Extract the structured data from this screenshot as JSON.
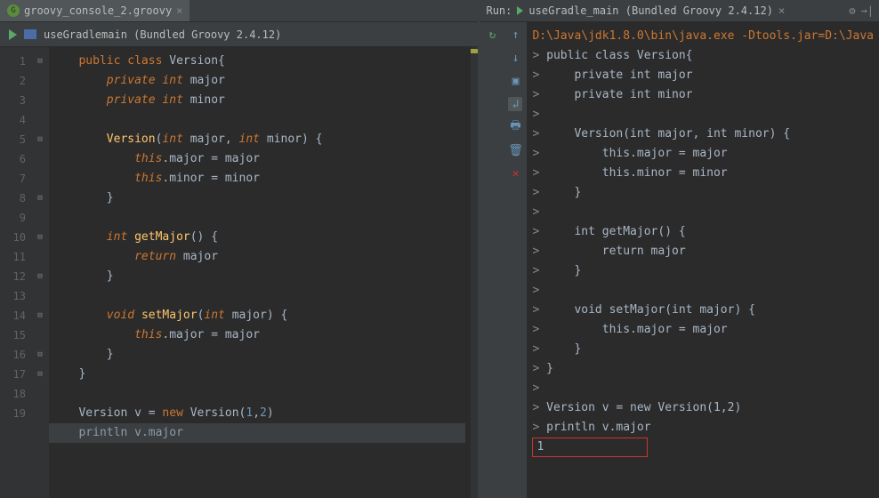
{
  "editor": {
    "tab": {
      "filename": "groovy_console_2.groovy"
    },
    "breadcrumb": "useGradlemain (Bundled Groovy 2.4.12)",
    "lines": [
      "1",
      "2",
      "3",
      "4",
      "5",
      "6",
      "7",
      "8",
      "9",
      "10",
      "11",
      "12",
      "13",
      "14",
      "15",
      "16",
      "17",
      "18",
      "19",
      ""
    ],
    "code": {
      "l1": {
        "pre": "   ",
        "kw1": "public",
        "sp1": " ",
        "kw2": "class",
        "sp2": " ",
        "name": "Version",
        "br": "{"
      },
      "l2": {
        "pre": "       ",
        "kw1": "private",
        "sp1": " ",
        "kw2": "int",
        "sp2": " ",
        "name": "major"
      },
      "l3": {
        "pre": "       ",
        "kw1": "private",
        "sp1": " ",
        "kw2": "int",
        "sp2": " ",
        "name": "minor"
      },
      "l5": {
        "pre": "       ",
        "name": "Version",
        "lp": "(",
        "kw1": "int",
        "sp1": " ",
        "p1": "major",
        "cm": ", ",
        "kw2": "int",
        "sp2": " ",
        "p2": "minor",
        "rp": ")",
        "sp3": " ",
        "br": "{"
      },
      "l6": {
        "pre": "           ",
        "kw": "this",
        "dot": ".",
        "f": "major",
        "eq": " = ",
        "v": "major"
      },
      "l7": {
        "pre": "           ",
        "kw": "this",
        "dot": ".",
        "f": "minor",
        "eq": " = ",
        "v": "minor"
      },
      "l8": {
        "pre": "       ",
        "br": "}"
      },
      "l10": {
        "pre": "       ",
        "kw": "int",
        "sp": " ",
        "name": "getMajor",
        "pr": "() {"
      },
      "l11": {
        "pre": "           ",
        "kw": "return",
        "sp": " ",
        "v": "major"
      },
      "l12": {
        "pre": "       ",
        "br": "}"
      },
      "l14": {
        "pre": "       ",
        "kw": "void",
        "sp": " ",
        "name": "setMajor",
        "lp": "(",
        "kw2": "int",
        "sp2": " ",
        "p": "major",
        "rp": ") {"
      },
      "l15": {
        "pre": "           ",
        "kw": "this",
        "dot": ".",
        "f": "major",
        "eq": " = ",
        "v": "major"
      },
      "l16": {
        "pre": "       ",
        "br": "}"
      },
      "l17": {
        "pre": "   ",
        "br": "}"
      },
      "l19": {
        "pre": "   ",
        "t": "Version",
        "sp": " ",
        "v": "v",
        "eq": " = ",
        "kw": "new",
        "sp2": " ",
        "cls": "Version",
        "lp": "(",
        "n1": "1",
        "cm": ",",
        "n2": "2",
        "rp": ")"
      },
      "l20": {
        "pre": "   ",
        "fn": "println",
        "sp": " ",
        "v": "v",
        "dot": ".",
        "f": "major"
      }
    }
  },
  "run": {
    "label": "Run:",
    "tab": "useGradle_main (Bundled Groovy 2.4.12)",
    "cmd": "D:\\Java\\jdk1.8.0\\bin\\java.exe -Dtools.jar=D:\\Java",
    "gt": ">",
    "lines": {
      "l1": "public class Version{",
      "l2": "    private int major",
      "l3": "    private int minor",
      "l4": "",
      "l5": "    Version(int major, int minor) {",
      "l6": "        this.major = major",
      "l7": "        this.minor = minor",
      "l8": "    }",
      "l9": "",
      "l10": "    int getMajor() {",
      "l11": "        return major",
      "l12": "    }",
      "l13": "",
      "l14": "    void setMajor(int major) {",
      "l15": "        this.major = major",
      "l16": "    }",
      "l17": "}",
      "l18": "Version v = new Version(1,2)",
      "l19": "println v.major"
    },
    "result": "1"
  }
}
